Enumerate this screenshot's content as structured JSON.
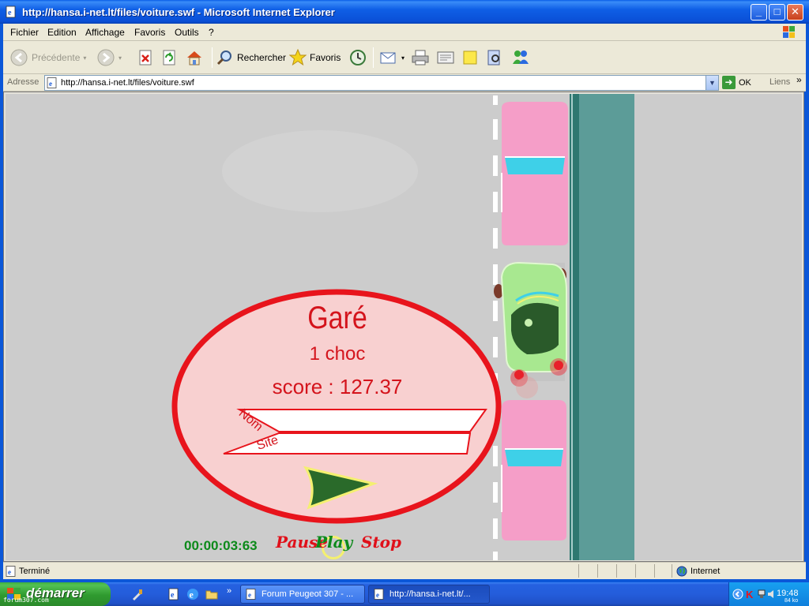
{
  "window": {
    "title": "http://hansa.i-net.lt/files/voiture.swf - Microsoft Internet Explorer",
    "minimize": "_",
    "maximize": "□",
    "close": "✕"
  },
  "menu": {
    "items": [
      "Fichier",
      "Edition",
      "Affichage",
      "Favoris",
      "Outils",
      "?"
    ]
  },
  "toolbar": {
    "back": "Précédente",
    "search": "Rechercher",
    "favorites": "Favoris"
  },
  "address": {
    "label": "Adresse",
    "url": "http://hansa.i-net.lt/files/voiture.swf",
    "go": "OK",
    "links": "Liens",
    "links_more": "»"
  },
  "game": {
    "result_title": "Garé",
    "shocks": "1 choc",
    "score": "score : 127.37",
    "name_label": "Nom",
    "site_label": "Site",
    "timer": "00:00:03:63",
    "pause": "Pause",
    "play": "Play",
    "stop": "Stop",
    "colors": {
      "background": "#cccccc",
      "pink_car": "#f59ec8",
      "windshield": "#3ed0e8",
      "player_car": "#a8e890",
      "sidewalk": "#5c9c98",
      "dialog_border": "#e8141c",
      "dialog_fill": "#f8d0d0"
    }
  },
  "status": {
    "text": "Terminé",
    "zone": "Internet"
  },
  "taskbar": {
    "start": "démarrer",
    "watermark": "forum307.com",
    "tasks": [
      {
        "label": "Forum Peugeot 307 - ..."
      },
      {
        "label": "http://hansa.i-net.lt/..."
      }
    ],
    "more": "»",
    "clock": "19:48",
    "kb": "84 ko"
  }
}
